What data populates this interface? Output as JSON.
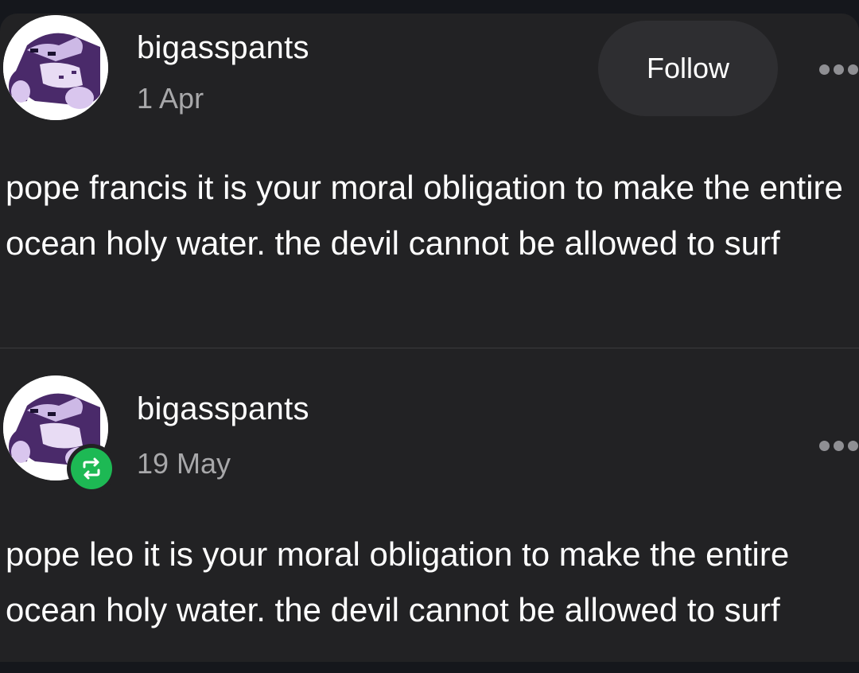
{
  "posts": [
    {
      "username": "bigasspants",
      "date": "1 Apr",
      "follow_label": "Follow",
      "body": "pope francis it is your moral obligation to make the entire ocean holy water. the devil cannot be allowed to surf",
      "is_reblog": false
    },
    {
      "username": "bigasspants",
      "date": "19 May",
      "body": "pope leo it is your moral obligation to make the entire ocean holy water. the devil cannot be allowed to surf",
      "is_reblog": true
    }
  ],
  "icons": {
    "avatar": "sleeping-snorlax-pixel-avatar",
    "more": "more-horizontal-icon",
    "reblog": "reblog-icon"
  },
  "colors": {
    "background": "#222224",
    "text": "#ffffff",
    "secondary_text": "#a8a8aa",
    "follow_button_bg": "#2e2e31",
    "reblog_badge": "#1db954",
    "avatar_purple": "#4a2a6a"
  }
}
